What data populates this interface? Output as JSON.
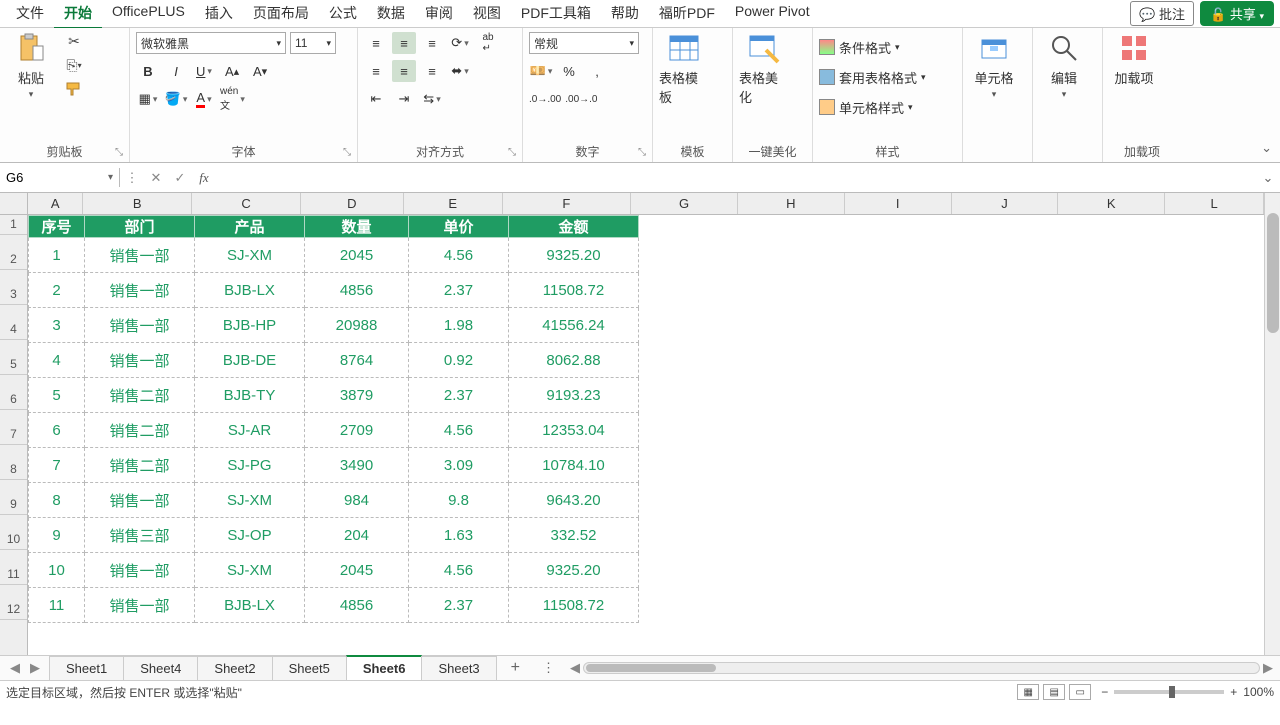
{
  "menu": {
    "items": [
      "文件",
      "开始",
      "OfficePLUS",
      "插入",
      "页面布局",
      "公式",
      "数据",
      "审阅",
      "视图",
      "PDF工具箱",
      "帮助",
      "福昕PDF",
      "Power Pivot"
    ],
    "active_index": 1,
    "comment_btn": "批注",
    "share_btn": "共享"
  },
  "ribbon": {
    "clipboard": {
      "paste": "粘贴",
      "label": "剪贴板"
    },
    "font": {
      "name": "微软雅黑",
      "size": "11",
      "label": "字体"
    },
    "alignment": {
      "label": "对齐方式"
    },
    "number": {
      "format": "常规",
      "label": "数字"
    },
    "templates": {
      "tpl": "表格模板",
      "beauty": "表格美化",
      "label": "模板",
      "label2": "一键美化"
    },
    "styles": {
      "cond": "条件格式",
      "table_fmt": "套用表格格式",
      "cell_fmt": "单元格样式",
      "label": "样式"
    },
    "cells": {
      "label": "单元格"
    },
    "editing": {
      "label": "编辑"
    },
    "addins": {
      "btn": "加载项",
      "label": "加载项"
    }
  },
  "namebox": "G6",
  "columns": {
    "widths": [
      56,
      110,
      110,
      104,
      100,
      130,
      108,
      108,
      108,
      108,
      108,
      100
    ],
    "letters": [
      "A",
      "B",
      "C",
      "D",
      "E",
      "F",
      "G",
      "H",
      "I",
      "J",
      "K",
      "L"
    ]
  },
  "table": {
    "headers": [
      "序号",
      "部门",
      "产品",
      "数量",
      "单价",
      "金额"
    ],
    "rows": [
      [
        "1",
        "销售一部",
        "SJ-XM",
        "2045",
        "4.56",
        "9325.20"
      ],
      [
        "2",
        "销售一部",
        "BJB-LX",
        "4856",
        "2.37",
        "11508.72"
      ],
      [
        "3",
        "销售一部",
        "BJB-HP",
        "20988",
        "1.98",
        "41556.24"
      ],
      [
        "4",
        "销售一部",
        "BJB-DE",
        "8764",
        "0.92",
        "8062.88"
      ],
      [
        "5",
        "销售二部",
        "BJB-TY",
        "3879",
        "2.37",
        "9193.23"
      ],
      [
        "6",
        "销售二部",
        "SJ-AR",
        "2709",
        "4.56",
        "12353.04"
      ],
      [
        "7",
        "销售二部",
        "SJ-PG",
        "3490",
        "3.09",
        "10784.10"
      ],
      [
        "8",
        "销售一部",
        "SJ-XM",
        "984",
        "9.8",
        "9643.20"
      ],
      [
        "9",
        "销售三部",
        "SJ-OP",
        "204",
        "1.63",
        "332.52"
      ],
      [
        "10",
        "销售一部",
        "SJ-XM",
        "2045",
        "4.56",
        "9325.20"
      ],
      [
        "11",
        "销售一部",
        "BJB-LX",
        "4856",
        "2.37",
        "11508.72"
      ]
    ]
  },
  "row_numbers": [
    "1",
    "2",
    "3",
    "4",
    "5",
    "6",
    "7",
    "8",
    "9",
    "10",
    "11",
    "12"
  ],
  "sheets": {
    "tabs": [
      "Sheet1",
      "Sheet4",
      "Sheet2",
      "Sheet5",
      "Sheet6",
      "Sheet3"
    ],
    "active_index": 4
  },
  "status": {
    "msg": "选定目标区域，然后按 ENTER 或选择\"粘贴\"",
    "zoom": "100%"
  }
}
